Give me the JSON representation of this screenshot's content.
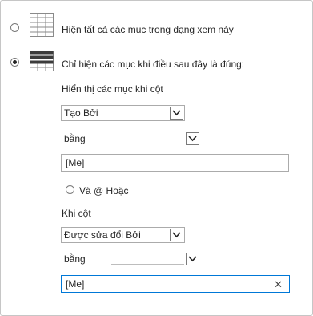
{
  "options": {
    "show_all": {
      "label": "Hiện tất cả các mục trong dạng xem này",
      "selected": false,
      "icon": "list-view-icon"
    },
    "filter": {
      "label": "Chỉ hiện các mục khi điều sau đây là đúng:",
      "selected": true,
      "icon": "filtered-list-icon"
    }
  },
  "condition1": {
    "heading": "Hiển thị các mục khi cột",
    "column": "Tạo Bởi",
    "operator": "bằng",
    "value": "[Me]"
  },
  "connector": {
    "label": "Và @ Hoặc"
  },
  "condition2": {
    "heading": "Khi cột",
    "column": "Được sửa đổi Bởi",
    "operator": "bằng",
    "value": "[Me]",
    "clear_symbol": "✕"
  },
  "colors": {
    "focus_border": "#0078d7",
    "border": "#ababab"
  }
}
